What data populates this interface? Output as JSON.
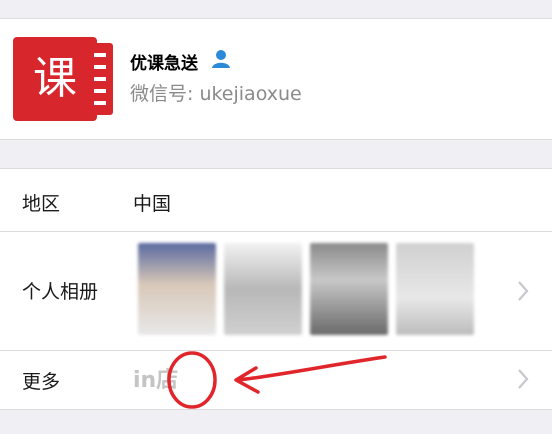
{
  "profile": {
    "logo_char": "课",
    "name": "优课急送",
    "wechat_id": "微信号: ukejiaoxue",
    "brand_color": "#d8262d"
  },
  "rows": {
    "region_label": "地区",
    "region_value": "中国",
    "album_label": "个人相册",
    "more_label": "更多",
    "store_icon_text": "in店"
  },
  "icons": {
    "verify": "person-verify-icon",
    "chevron": "chevron-right-icon"
  },
  "annotation_color": "#e0262b"
}
